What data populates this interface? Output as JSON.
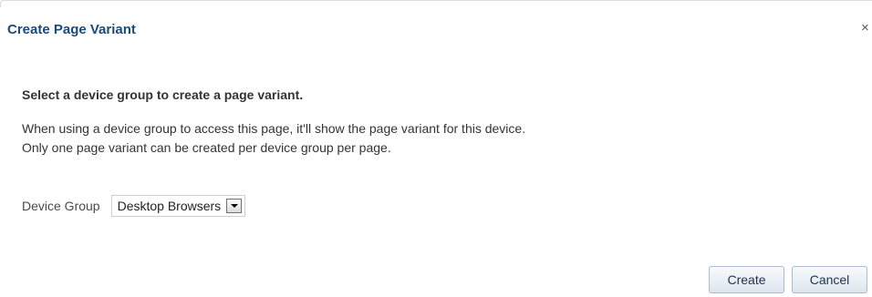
{
  "dialog": {
    "title": "Create Page Variant",
    "close_symbol": "×",
    "instruction": "Select a device group to create a page variant.",
    "description_lines": [
      "When using a device group to access this page, it'll show the page variant for this device.",
      "Only one page variant can be created per device group per page."
    ],
    "device_group": {
      "label": "Device Group",
      "selected": "Desktop Browsers"
    },
    "buttons": {
      "create": "Create",
      "cancel": "Cancel"
    }
  },
  "colors": {
    "title": "#1b4a7a",
    "text": "#333333",
    "button_border": "#a9bccf"
  }
}
